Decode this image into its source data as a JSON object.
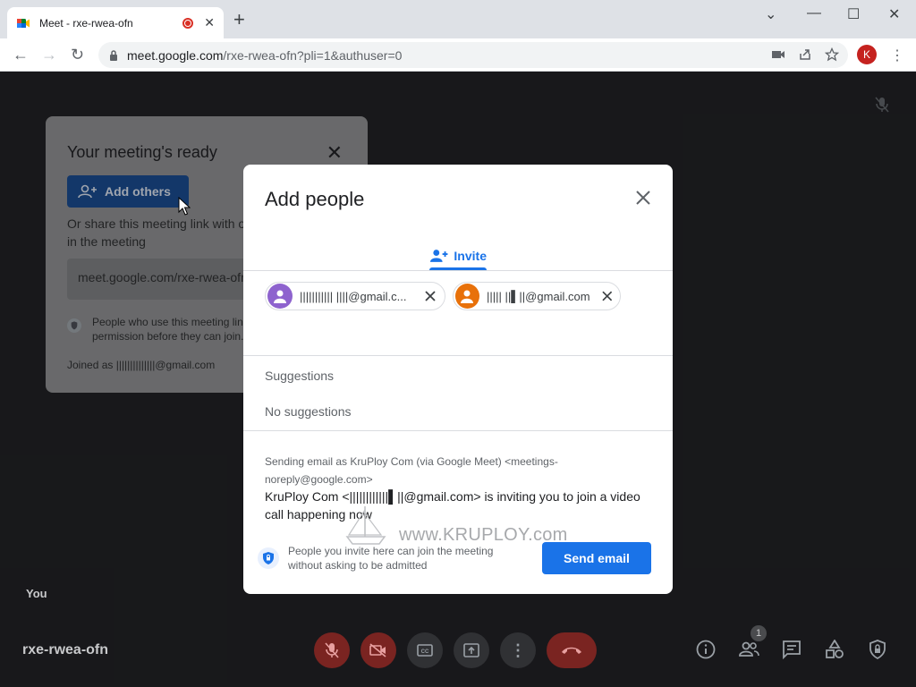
{
  "browser": {
    "tab_title": "Meet - rxe-rwea-ofn",
    "url_host": "meet.google.com",
    "url_path": "/rxe-rwea-ofn?pli=1&authuser=0",
    "profile_initial": "K"
  },
  "ready_card": {
    "title": "Your meeting's ready",
    "add_others_label": "Add others",
    "share_text": "Or share this meeting link with others you want in the meeting",
    "link": "meet.google.com/rxe-rwea-ofn",
    "permission_text": "People who use this meeting link must get your permission before they can join.",
    "joined_as": "Joined as ||||||||||||||@gmail.com"
  },
  "dialog": {
    "title": "Add people",
    "tab_label": "Invite",
    "chips": [
      {
        "email": "||||||||||| ||||@gmail.c...",
        "color": "#8e63ce"
      },
      {
        "email": "||||| ||▌||@gmail.com",
        "color": "#e8710a"
      }
    ],
    "suggestions_label": "Suggestions",
    "no_suggestions": "No suggestions",
    "sending_as": "Sending email as KruPloy Com (via Google Meet) <meetings-noreply@google.com>",
    "invite_message": "KruPloy Com <||||||||||||▌||@gmail.com> is inviting you to join a video call happening now",
    "footer_text": "People you invite here can join the meeting without asking to be admitted",
    "send_label": "Send email",
    "watermark": "www.KRUPLOY.com"
  },
  "meet": {
    "self_label": "You",
    "meeting_code": "rxe-rwea-ofn",
    "participant_count": "1"
  },
  "colors": {
    "accent": "#1a73e8",
    "danger": "#d93025"
  }
}
